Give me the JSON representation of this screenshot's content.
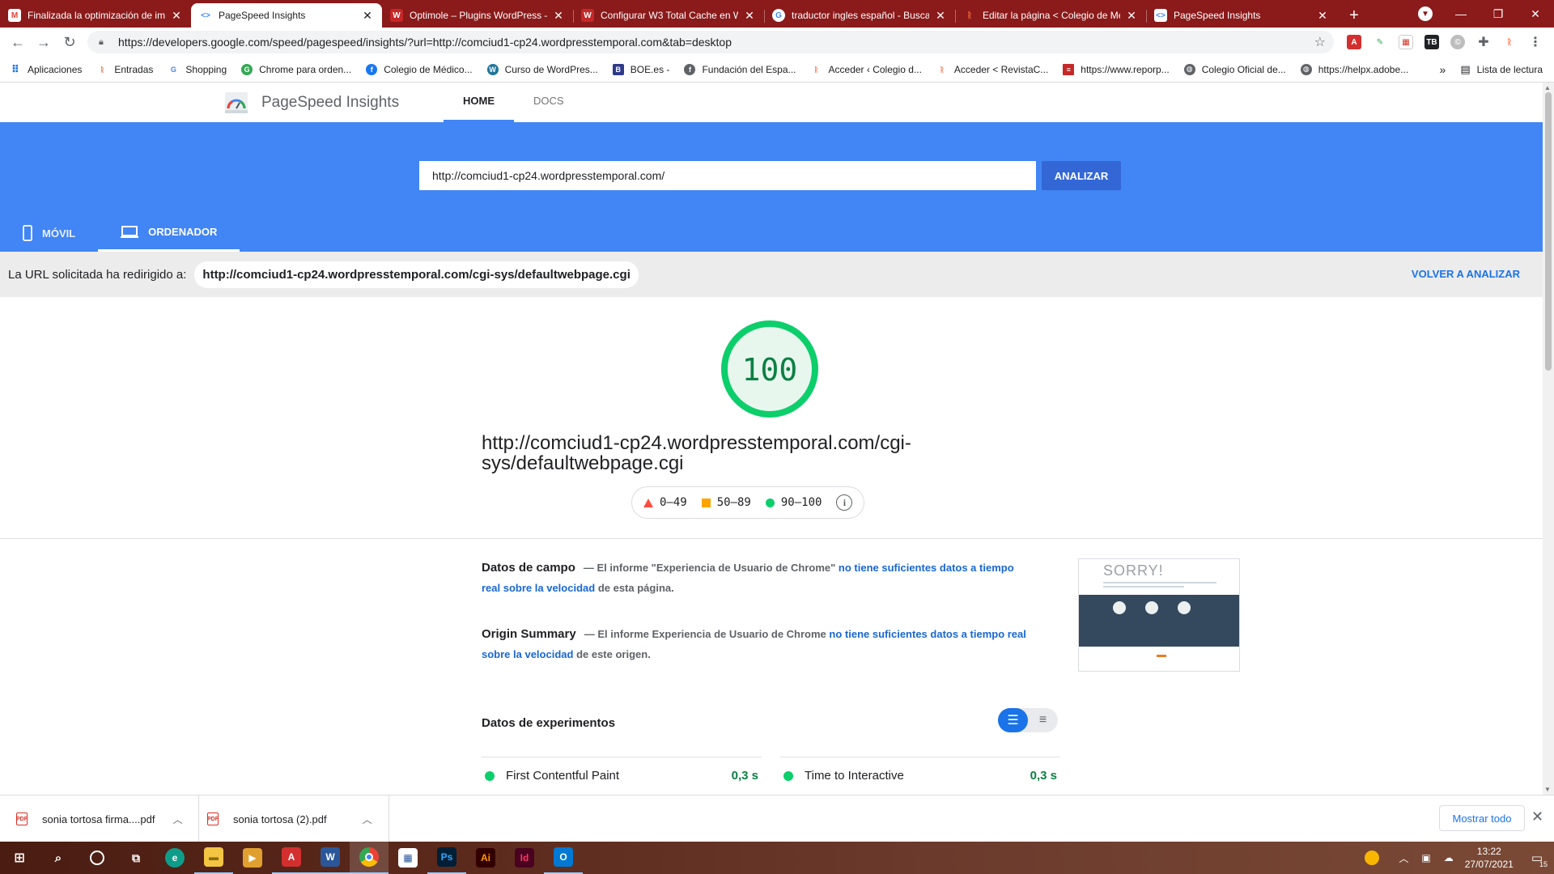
{
  "browser": {
    "tabs": [
      {
        "title": "Finalizada la optimización de im",
        "icon": "gmail-icon",
        "color": "#ea4335"
      },
      {
        "title": "PageSpeed Insights",
        "icon": "pagespeed-icon",
        "color": "#4285f4",
        "active": true
      },
      {
        "title": "Optimole – Plugins WordPress –",
        "icon": "w-icon",
        "color": "#c62828"
      },
      {
        "title": "Configurar W3 Total Cache en W",
        "icon": "w-icon",
        "color": "#c62828"
      },
      {
        "title": "traductor ingles español - Busca",
        "icon": "google-icon",
        "color": "#ffffff"
      },
      {
        "title": "Editar la página < Colegio de Mé",
        "icon": "colegio-icon",
        "color": "#ff7043"
      },
      {
        "title": "PageSpeed Insights",
        "icon": "pagespeed-icon",
        "color": "#4285f4"
      }
    ],
    "close_glyph": "✕",
    "new_tab_glyph": "+",
    "url": "https://developers.google.com/speed/pagespeed/insights/?url=http://comciud1-cp24.wordpresstemporal.com&tab=desktop",
    "bookmarks": [
      {
        "label": "Aplicaciones",
        "icon": "apps-grid-icon",
        "color": "#1a73e8"
      },
      {
        "label": "Entradas",
        "icon": "colegio-icon",
        "color": "#ff7043"
      },
      {
        "label": "Shopping",
        "icon": "google-icon",
        "color": "#4285f4"
      },
      {
        "label": "Chrome para orden...",
        "icon": "google-icon",
        "color": "#34a853"
      },
      {
        "label": "Colegio de Médico...",
        "icon": "facebook-icon",
        "color": "#1877f2"
      },
      {
        "label": "Curso de WordPres...",
        "icon": "wordpress-icon",
        "color": "#21759b"
      },
      {
        "label": "BOE.es -",
        "icon": "boe-icon",
        "color": "#2e3a87"
      },
      {
        "label": "Fundación del Espa...",
        "icon": "facebook-icon",
        "color": "#5f6368"
      },
      {
        "label": "Acceder ‹ Colegio d...",
        "icon": "colegio-icon",
        "color": "#ff7043"
      },
      {
        "label": "Acceder < RevistaC...",
        "icon": "colegio-icon",
        "color": "#ff7043"
      },
      {
        "label": "https://www.reporp...",
        "icon": "flag-icon",
        "color": "#c62828"
      },
      {
        "label": "Colegio Oficial de...",
        "icon": "globe-icon",
        "color": "#5f6368"
      },
      {
        "label": "https://helpx.adobe...",
        "icon": "globe-icon",
        "color": "#5f6368"
      }
    ],
    "bookmarks_more": "»",
    "reading_list": "Lista de lectura"
  },
  "psi": {
    "title": "PageSpeed Insights",
    "nav": {
      "home": "HOME",
      "docs": "DOCS"
    },
    "input_value": "http://comciud1-cp24.wordpresstemporal.com/",
    "analyze": "ANALIZAR",
    "device_tabs": {
      "mobile": "MÓVIL",
      "desktop": "ORDENADOR"
    },
    "redirect": {
      "label": "La URL solicitada ha redirigido a:",
      "url": "http://comciud1-cp24.wordpresstemporal.com/cgi-sys/defaultwebpage.cgi",
      "reanalyze": "VOLVER A ANALIZAR"
    },
    "score": 100,
    "score_display": "100",
    "score_color": "#0cce6b",
    "final_url": "http://comciud1-cp24.wordpresstemporal.com/cgi-sys/defaultwebpage.cgi",
    "legend": {
      "fail": "0–49",
      "average": "50–89",
      "pass": "90–100"
    },
    "field": {
      "title": "Datos de campo",
      "pre": "— El informe \"Experiencia de Usuario de Chrome\"",
      "link": "no tiene suficientes datos a tiempo real sobre la velocidad",
      "post": "de esta página."
    },
    "origin": {
      "title": "Origin Summary",
      "pre": "— El informe Experiencia de Usuario de Chrome",
      "link": "no tiene suficientes datos a tiempo real sobre la velocidad",
      "post": "de este origen."
    },
    "screenshot_text": "SORRY!",
    "lab_title": "Datos de experimentos",
    "metrics": [
      {
        "name": "First Contentful Paint",
        "value": "0,3 s"
      },
      {
        "name": "Time to Interactive",
        "value": "0,3 s"
      }
    ]
  },
  "downloads": {
    "items": [
      {
        "name": "sonia tortosa firma....pdf"
      },
      {
        "name": "sonia tortosa (2).pdf"
      }
    ],
    "show_all": "Mostrar todo"
  },
  "taskbar": {
    "time": "13:22",
    "date": "27/07/2021",
    "notifications": "15"
  }
}
